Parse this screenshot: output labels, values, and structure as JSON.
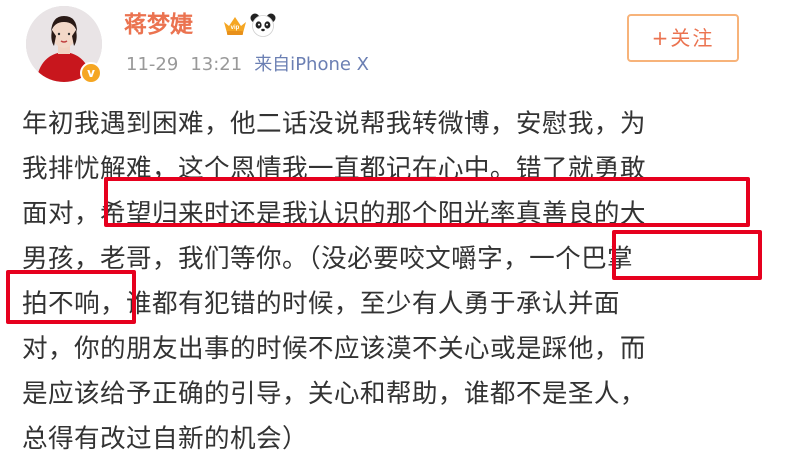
{
  "user": {
    "name": "蒋梦婕",
    "vip_text": "vip",
    "avatar_badge": "v"
  },
  "meta": {
    "date": "11-29",
    "time": "13:21",
    "source": "来自iPhone X"
  },
  "follow_button": {
    "label": "+关注"
  },
  "post": {
    "lines": [
      "年初我遇到困难，他二话没说帮我转微博，安慰我，为",
      "我排忧解难，这个恩情我一直都记在心中。错了就勇敢",
      "面对，希望归来时还是我认识的那个阳光率真善良的大",
      "男孩，老哥，我们等你。（没必要咬文嚼字，一个巴掌",
      "拍不响，谁都有犯错的时候，至少有人勇于承认并面",
      "对，你的朋友出事的时候不应该漠不关心或是踩他，而",
      "是应该给予正确的引导，关心和帮助，谁都不是圣人，",
      "总得有改过自新的机会）"
    ],
    "highlights": [
      "希望归来时还是我认识的那个阳光率真善良的大",
      "一个巴掌",
      "拍不响，"
    ]
  },
  "colors": {
    "username": "#eb7350",
    "highlight_box": "#e6001e",
    "meta_text": "#999999",
    "body_text": "#333333",
    "follow_border": "#f7b37a"
  },
  "icons": {
    "vip": "crown-vip-icon",
    "panda": "panda-icon",
    "verified": "verified-badge-icon"
  }
}
